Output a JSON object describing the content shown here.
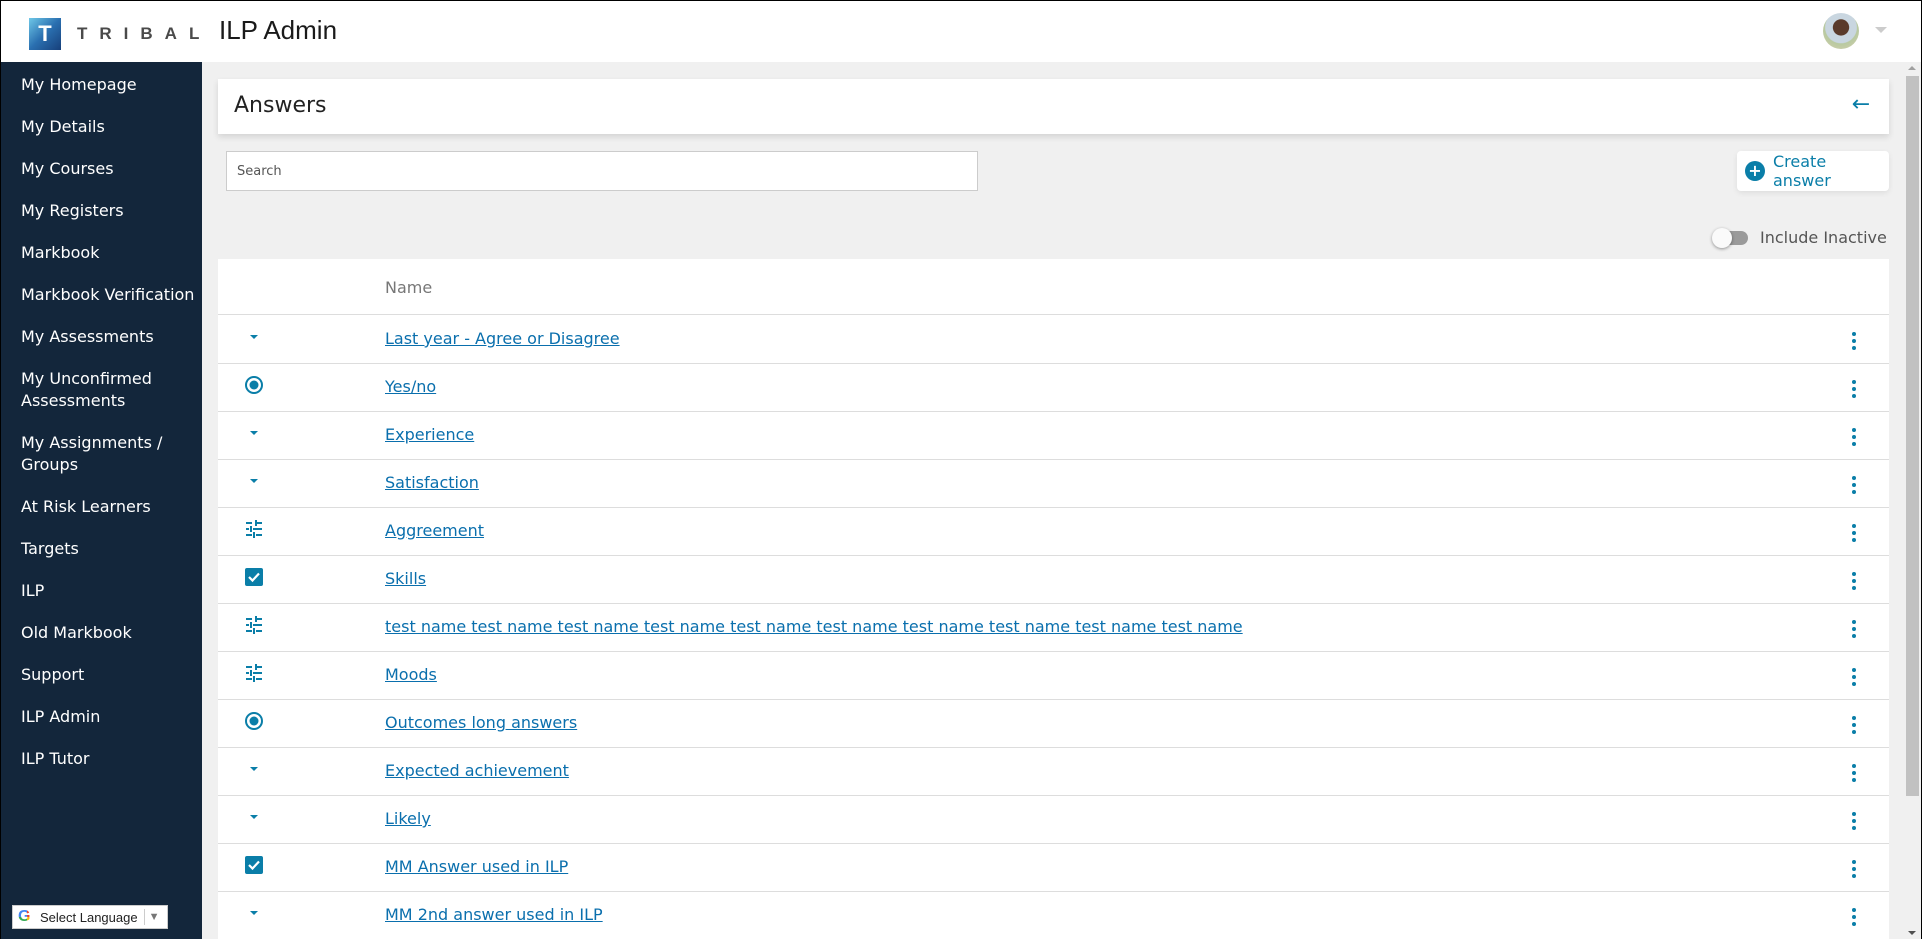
{
  "header": {
    "logo_letter": "T",
    "logo_text": "TRIBAL",
    "app_title": "ILP Admin"
  },
  "sidebar": {
    "items": [
      {
        "label": "My Homepage"
      },
      {
        "label": "My Details"
      },
      {
        "label": "My Courses"
      },
      {
        "label": "My Registers"
      },
      {
        "label": "Markbook"
      },
      {
        "label": "Markbook Verification"
      },
      {
        "label": "My Assessments"
      },
      {
        "label": "My Unconfirmed Assessments"
      },
      {
        "label": "My Assignments / Groups"
      },
      {
        "label": "At Risk Learners"
      },
      {
        "label": "Targets"
      },
      {
        "label": "ILP"
      },
      {
        "label": "Old Markbook"
      },
      {
        "label": "Support"
      },
      {
        "label": "ILP Admin"
      },
      {
        "label": "ILP Tutor"
      }
    ],
    "language_select": "Select Language",
    "language_arrow": "▼",
    "google_glyph": "G"
  },
  "page": {
    "title": "Answers",
    "back_icon": "←",
    "search_placeholder": "Search",
    "create_label": "Create answer",
    "create_icon": "+",
    "include_inactive_label": "Include Inactive",
    "include_inactive": false
  },
  "table": {
    "columns": [
      "",
      "Name",
      ""
    ],
    "rows": [
      {
        "type": "dropdown",
        "name": "Last year - Agree or Disagree"
      },
      {
        "type": "radio",
        "name": "Yes/no"
      },
      {
        "type": "dropdown",
        "name": "Experience"
      },
      {
        "type": "dropdown",
        "name": "Satisfaction"
      },
      {
        "type": "slider",
        "name": "Aggreement"
      },
      {
        "type": "checkbox",
        "name": "Skills"
      },
      {
        "type": "slider",
        "name": "test name test name test name test name test name test name test name test name test name test name"
      },
      {
        "type": "slider",
        "name": "Moods"
      },
      {
        "type": "radio",
        "name": "Outcomes long answers"
      },
      {
        "type": "dropdown",
        "name": "Expected achievement"
      },
      {
        "type": "dropdown",
        "name": "Likely"
      },
      {
        "type": "checkbox",
        "name": "MM Answer used in ILP"
      },
      {
        "type": "dropdown",
        "name": "MM 2nd answer used in ILP"
      }
    ]
  },
  "colors": {
    "sidebar_bg": "#13263b",
    "accent": "#0a7ea8",
    "link": "#0a6fad"
  }
}
